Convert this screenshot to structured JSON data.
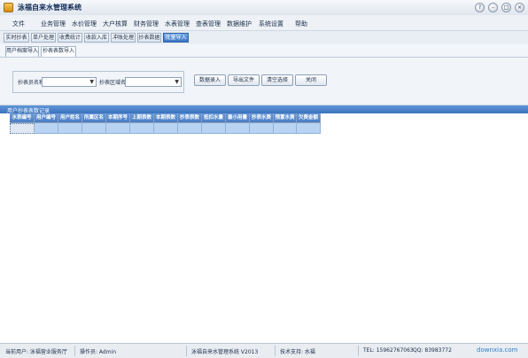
{
  "window": {
    "title": "泳福自来水管理系统"
  },
  "menu": [
    "文件",
    "业务管理",
    "水价管理",
    "大户核算",
    "财务管理",
    "水表管理",
    "查表管理",
    "数据维护",
    "系统设置",
    "帮助"
  ],
  "nav": [
    "实时抄表",
    "单户处理",
    "收费统计",
    "收款入库",
    "冲账处理",
    "抄表数据",
    "批量导入"
  ],
  "tabs": [
    "用户档案导入",
    "抄表表数导入"
  ],
  "filters": {
    "label1": "抄表员名称:",
    "label2": "抄表区域名称:"
  },
  "actions": [
    "数据录入",
    "导出文件",
    "清空选择",
    "关闭"
  ],
  "grid": {
    "title": "用户抄表表数记录",
    "columns": [
      "水表编号",
      "用户编号",
      "用户姓名",
      "所属区名",
      "本期序号",
      "上期表数",
      "本期表数",
      "抄表表数",
      "抵扣水量",
      "最小用量",
      "抄表水费",
      "预置水费",
      "欠费金额"
    ]
  },
  "status": {
    "login": "当前用户:  泳福营业服务厅",
    "operator": "操作员:  Admin",
    "version": "泳福自来水管理系统  V2013",
    "support": "技术支持:  水福",
    "tel": "TEL:  15962767063",
    "qq": "QQ:  83983772",
    "brand": "downxia.com"
  },
  "colors": {
    "accent": "#3c72bd",
    "header": "#4a7cc2",
    "cell": "#b9d3f2"
  }
}
